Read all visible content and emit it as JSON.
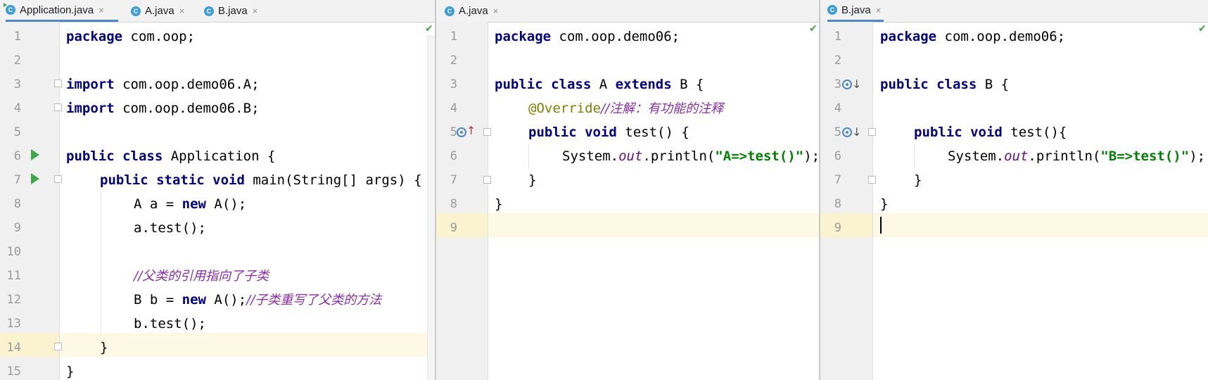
{
  "pane1": {
    "tabs": [
      {
        "label": "Application.java",
        "icon": "C",
        "close": "×"
      },
      {
        "label": "A.java",
        "icon": "C",
        "close": "×"
      },
      {
        "label": "B.java",
        "icon": "C",
        "close": "×"
      }
    ],
    "check": "✔",
    "line_numbers": [
      "1",
      "2",
      "3",
      "4",
      "5",
      "6",
      "7",
      "8",
      "9",
      "10",
      "11",
      "12",
      "13",
      "14",
      "15"
    ],
    "code": {
      "l1_kw": "package",
      "l1_rest": " com.oop;",
      "l3_kw": "import",
      "l3_rest": " com.oop.demo06.A;",
      "l4_kw": "import",
      "l4_rest": " com.oop.demo06.B;",
      "l6_kw": "public class",
      "l6_rest": " Application {",
      "l7_kw": "public static void",
      "l7_rest": " main(String[] args) {",
      "l8_pre": "A a = ",
      "l8_kw": "new",
      "l8_rest": " A();",
      "l9": "a.test();",
      "l11_cmt": "//父类的引用指向了子类",
      "l12_pre": "B b = ",
      "l12_kw": "new",
      "l12_rest": " A();",
      "l12_cmt": "//子类重写了父类的方法",
      "l13": "b.test();",
      "l14": "}",
      "l15": "}"
    }
  },
  "pane2": {
    "tab": {
      "label": "A.java",
      "icon": "C",
      "close": "×"
    },
    "check": "✔",
    "line_numbers": [
      "1",
      "2",
      "3",
      "4",
      "5",
      "6",
      "7",
      "8",
      "9"
    ],
    "code": {
      "l1_kw": "package",
      "l1_rest": " com.oop.demo06;",
      "l3_kw1": "public class",
      "l3_mid": " A ",
      "l3_kw2": "extends",
      "l3_rest": " B {",
      "l4_ann": "@Override",
      "l4_cmt": "//注解：有功能的注释",
      "l5_kw": "public void",
      "l5_rest": " test() {",
      "l6_pre": "System.",
      "l6_fld": "out",
      "l6_mid": ".println(",
      "l6_str": "\"A=>test()\"",
      "l6_rest": ");",
      "l7": "}",
      "l8": "}"
    },
    "arrow_up": "↑"
  },
  "pane3": {
    "tab": {
      "label": "B.java",
      "icon": "C",
      "close": "×"
    },
    "check": "✔",
    "line_numbers": [
      "1",
      "2",
      "3",
      "4",
      "5",
      "6",
      "7",
      "8",
      "9"
    ],
    "code": {
      "l1_kw": "package",
      "l1_rest": " com.oop.demo06;",
      "l3_kw": "public class",
      "l3_rest": " B {",
      "l5_kw": "public void",
      "l5_rest": " test(){",
      "l6_pre": "System.",
      "l6_fld": "out",
      "l6_mid": ".println(",
      "l6_str": "\"B=>test()\"",
      "l6_rest": ");",
      "l7": "}",
      "l8": "}"
    },
    "arrow_down": "↓"
  }
}
